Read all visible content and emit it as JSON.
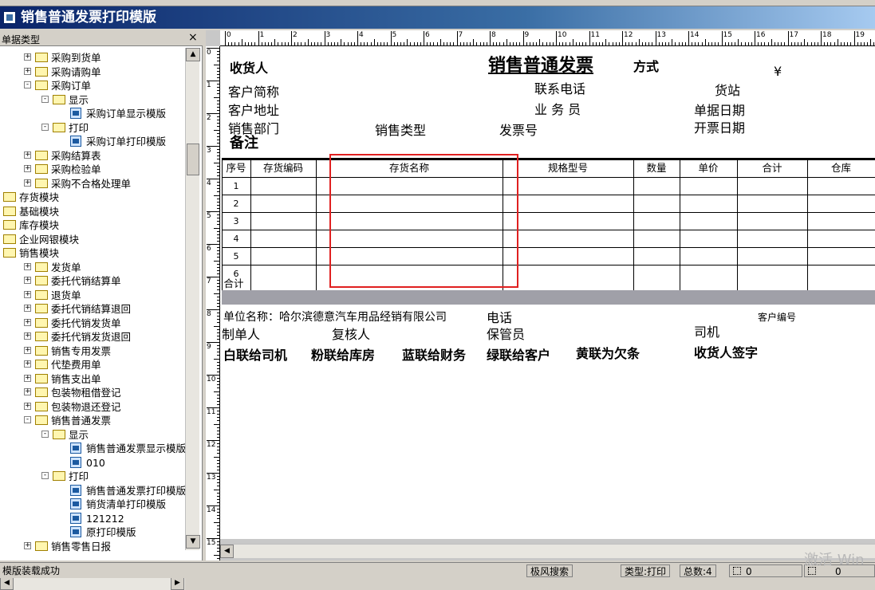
{
  "window": {
    "title": "销售普通发票打印模版"
  },
  "left_panel": {
    "header": "单据类型",
    "close_label": "×",
    "tree": [
      {
        "label": "采购到货单",
        "level": 1,
        "kind": "folder",
        "expander": "+"
      },
      {
        "label": "采购请购单",
        "level": 1,
        "kind": "folder",
        "expander": "+"
      },
      {
        "label": "采购订单",
        "level": 1,
        "kind": "folder",
        "expander": "-"
      },
      {
        "label": "显示",
        "level": 2,
        "kind": "folder",
        "expander": "-"
      },
      {
        "label": "采购订单显示模版",
        "level": 3,
        "kind": "doc",
        "expander": ""
      },
      {
        "label": "打印",
        "level": 2,
        "kind": "folder",
        "expander": "-"
      },
      {
        "label": "采购订单打印模版",
        "level": 3,
        "kind": "doc",
        "expander": ""
      },
      {
        "label": "采购结算表",
        "level": 1,
        "kind": "folder",
        "expander": "+"
      },
      {
        "label": "采购检验单",
        "level": 1,
        "kind": "folder",
        "expander": "+"
      },
      {
        "label": "采购不合格处理单",
        "level": 1,
        "kind": "folder",
        "expander": "+"
      },
      {
        "label": "存货模块",
        "level": 0,
        "kind": "folder",
        "expander": ""
      },
      {
        "label": "基础模块",
        "level": 0,
        "kind": "folder",
        "expander": ""
      },
      {
        "label": "库存模块",
        "level": 0,
        "kind": "folder",
        "expander": ""
      },
      {
        "label": "企业网银模块",
        "level": 0,
        "kind": "folder",
        "expander": ""
      },
      {
        "label": "销售模块",
        "level": 0,
        "kind": "folder",
        "expander": ""
      },
      {
        "label": "发货单",
        "level": 1,
        "kind": "folder",
        "expander": "+"
      },
      {
        "label": "委托代销结算单",
        "level": 1,
        "kind": "folder",
        "expander": "+"
      },
      {
        "label": "退货单",
        "level": 1,
        "kind": "folder",
        "expander": "+"
      },
      {
        "label": "委托代销结算退回",
        "level": 1,
        "kind": "folder",
        "expander": "+"
      },
      {
        "label": "委托代销发货单",
        "level": 1,
        "kind": "folder",
        "expander": "+"
      },
      {
        "label": "委托代销发货退回",
        "level": 1,
        "kind": "folder",
        "expander": "+"
      },
      {
        "label": "销售专用发票",
        "level": 1,
        "kind": "folder",
        "expander": "+"
      },
      {
        "label": "代垫费用单",
        "level": 1,
        "kind": "folder",
        "expander": "+"
      },
      {
        "label": "销售支出单",
        "level": 1,
        "kind": "folder",
        "expander": "+"
      },
      {
        "label": "包装物租借登记",
        "level": 1,
        "kind": "folder",
        "expander": "+"
      },
      {
        "label": "包装物退还登记",
        "level": 1,
        "kind": "folder",
        "expander": "+"
      },
      {
        "label": "销售普通发票",
        "level": 1,
        "kind": "folder",
        "expander": "-"
      },
      {
        "label": "显示",
        "level": 2,
        "kind": "folder",
        "expander": "-"
      },
      {
        "label": "销售普通发票显示模版",
        "level": 3,
        "kind": "doc",
        "expander": ""
      },
      {
        "label": "010",
        "level": 3,
        "kind": "doc",
        "expander": ""
      },
      {
        "label": "打印",
        "level": 2,
        "kind": "folder",
        "expander": "-"
      },
      {
        "label": "销售普通发票打印模版",
        "level": 3,
        "kind": "doc",
        "expander": ""
      },
      {
        "label": "销货清单打印模版",
        "level": 3,
        "kind": "doc",
        "expander": ""
      },
      {
        "label": "121212",
        "level": 3,
        "kind": "doc",
        "expander": ""
      },
      {
        "label": "原打印模版",
        "level": 3,
        "kind": "doc",
        "expander": ""
      },
      {
        "label": "销售零售日报",
        "level": 1,
        "kind": "folder",
        "expander": "+"
      }
    ]
  },
  "ruler": {
    "h_numbers": [
      "0",
      "1",
      "2",
      "3",
      "4",
      "5",
      "6",
      "7",
      "8",
      "9",
      "10",
      "11",
      "12",
      "13",
      "14",
      "15",
      "16",
      "17",
      "18",
      "19"
    ],
    "v_numbers": [
      "0",
      "1",
      "2",
      "3",
      "4",
      "5",
      "6",
      "7",
      "8",
      "9",
      "10",
      "11",
      "12",
      "13",
      "14",
      "15"
    ]
  },
  "template": {
    "receiver": "收货人",
    "title": "销售普通发票",
    "method": "方式",
    "currency": "¥",
    "customer_short": "客户简称",
    "contact_phone": "联系电话",
    "station": "货站",
    "customer_address": "客户地址",
    "salesman": "业 务 员",
    "doc_date": "单据日期",
    "sales_dept": "销售部门",
    "sales_type": "销售类型",
    "invoice_no": "发票号",
    "invoice_date": "开票日期",
    "remark": "备注",
    "table": {
      "headers": [
        "序号",
        "存货编码",
        "存货名称",
        "规格型号",
        "数量",
        "单价",
        "合计",
        "仓库"
      ],
      "rows": [
        "1",
        "2",
        "3",
        "4",
        "5",
        "6"
      ],
      "total_label": "合计"
    },
    "unit_name": "单位名称：哈尔滨德意汽车用品经销有限公司",
    "phone": "电话",
    "customer_code": "客户编号",
    "maker": "制单人",
    "reviewer": "复核人",
    "keeper": "保管员",
    "driver": "司机",
    "copy_white": "白联给司机",
    "copy_pink": "粉联给库房",
    "copy_blue": "蓝联给财务",
    "copy_green": "绿联给客户",
    "copy_yellow": "黄联为欠条",
    "receiver_sign": "收货人签字"
  },
  "statusbar": {
    "message": "模版装载成功",
    "ime": "极风搜索",
    "type": "类型:打印",
    "total": "总数:4",
    "x_val": "0",
    "y_val": "0"
  },
  "watermark": "激活 Win"
}
